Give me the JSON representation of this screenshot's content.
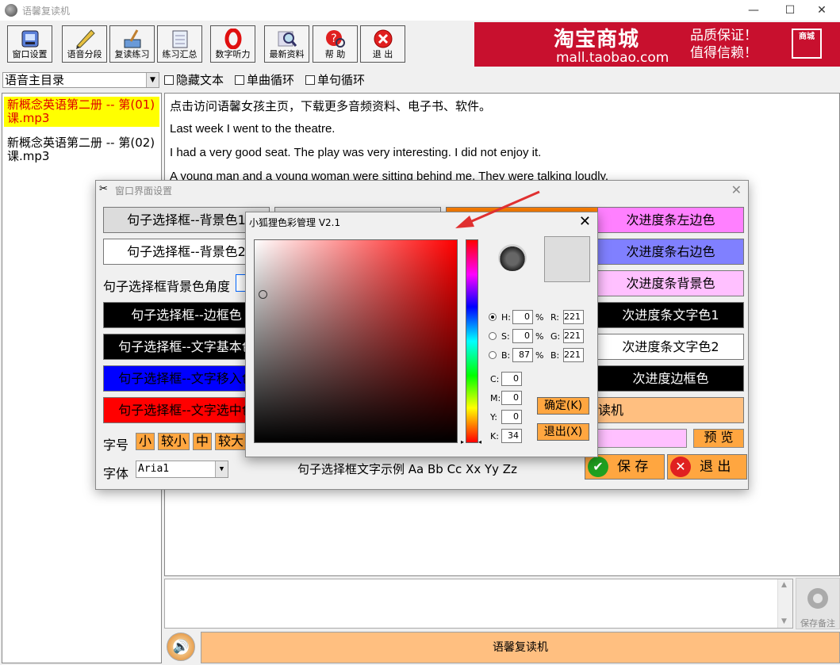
{
  "app": {
    "title": "语馨复读机"
  },
  "window_buttons": {
    "minimize": "—",
    "maximize": "☐",
    "close": "✕"
  },
  "toolbar": [
    {
      "label": "窗口设置",
      "icon": "window-settings-icon"
    },
    {
      "label": "语音分段",
      "icon": "pencil-icon"
    },
    {
      "label": "复读练习",
      "icon": "broom-icon"
    },
    {
      "label": "练习汇总",
      "icon": "notebook-icon"
    },
    {
      "label": "数字听力",
      "icon": "zero-icon"
    },
    {
      "label": "最新资料",
      "icon": "magnifier-icon"
    },
    {
      "label": "帮  助",
      "icon": "help-icon"
    },
    {
      "label": "退  出",
      "icon": "exit-icon"
    }
  ],
  "banner": {
    "brand": "淘宝商城",
    "url": "mall.taobao.com",
    "slogan1": "品质保证！",
    "slogan2": "值得信赖！",
    "cube": "商城"
  },
  "directory": {
    "selected": "语音主目录"
  },
  "options": {
    "hide_text": "隐藏文本",
    "single_track_loop": "单曲循环",
    "single_sentence_loop": "单句循环"
  },
  "playlist": [
    {
      "title": "新概念英语第二册 -- 第(01)课.mp3",
      "selected": true
    },
    {
      "title": "新概念英语第二册 -- 第(02)课.mp3",
      "selected": false
    }
  ],
  "text_lines": [
    "点击访问语馨女孩主页，下载更多音频资料、电子书、软件。",
    "Last week I went to the theatre.",
    "I had a very good seat. The play was very interesting. I did not enjoy it.",
    "A young man and a young woman were sitting behind me. They were talking loudly."
  ],
  "notes": {
    "save_label": "保存备注"
  },
  "status": {
    "text": "语馨复读机"
  },
  "settings_dialog": {
    "title": "窗口界面设置",
    "left_buttons": {
      "bg1": "句子选择框--背景色1",
      "bg2": "句子选择框--背景色2",
      "border": "句子选择框--边框色",
      "text_base": "句子选择框--文字基本色",
      "text_hover": "句子选择框--文字移入色",
      "text_selected": "句子选择框--文字选中色"
    },
    "angle_label": "句子选择框背景色角度",
    "right_buttons": {
      "left_border": "次进度条左边色",
      "right_border": "次进度条右边色",
      "bg": "次进度条背景色",
      "text1": "次进度条文字色1",
      "text2": "次进度条文字色2",
      "frame": "次进度边框色",
      "partial": "读机"
    },
    "size_label": "字号",
    "sizes": [
      "小",
      "较小",
      "中",
      "较大"
    ],
    "font_label": "字体",
    "font_value": "Aria1",
    "sample": "句子选择框文字示例 Aa Bb Cc Xx Yy Zz",
    "preview": "预  览",
    "save": "保  存",
    "exit": "退  出",
    "colors": {
      "gray": "#dcdcdc",
      "black": "#000000",
      "blue": "#0000ff",
      "red": "#ff0000",
      "pink": "#ff80ff",
      "lavender": "#8080ff",
      "light_pink": "#ffc0ff",
      "orange": "#ffbf80",
      "accent": "#ff8000"
    }
  },
  "color_picker": {
    "title": "小狐狸色彩管理 V2.1",
    "close": "✕",
    "hsb": [
      {
        "label": "H:",
        "value": "0",
        "unit": "%",
        "selected": true
      },
      {
        "label": "S:",
        "value": "0",
        "unit": "%",
        "selected": false
      },
      {
        "label": "B:",
        "value": "87",
        "unit": "%",
        "selected": false
      }
    ],
    "rgb": [
      {
        "label": "R:",
        "value": "221"
      },
      {
        "label": "G:",
        "value": "221"
      },
      {
        "label": "B:",
        "value": "221"
      }
    ],
    "cmyk": [
      {
        "label": "C:",
        "value": "0"
      },
      {
        "label": "M:",
        "value": "0"
      },
      {
        "label": "Y:",
        "value": "0"
      },
      {
        "label": "K:",
        "value": "34"
      }
    ],
    "ok": "确定(K)",
    "cancel": "退出(X)",
    "current_color": "#dddddd"
  }
}
